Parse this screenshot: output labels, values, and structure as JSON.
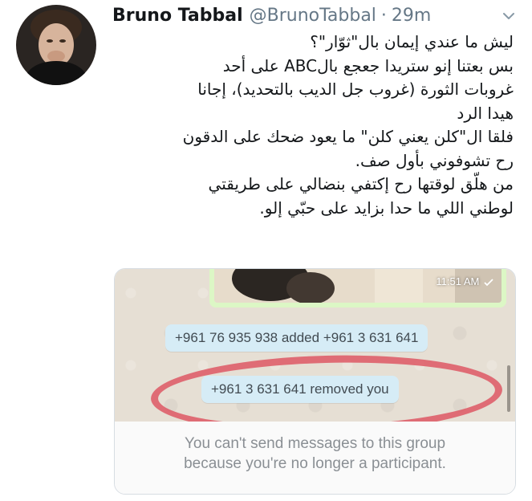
{
  "tweet": {
    "author_name": "Bruno Tabbal",
    "author_handle": "@BrunoTabbal",
    "separator": "·",
    "time": "29m",
    "lines": [
      "ليش ما عندي إيمان بال\"ثوّار\"؟",
      "بس بعتنا إنو ستريدا جعجع بالABC على أحد",
      "غروبات الثورة (غروب جل الديب بالتحديد)، إجانا",
      "هيدا الرد",
      "فلقا ال\"كلن يعني كلن\" ما يعود ضحك على الدقون",
      "رح تشوفوني بأول صف.",
      "من هلّق لوقتها رح إكتفي بنضالي على طريقتي",
      "لوطني اللي ما حدا بزايد على حبّي إلو."
    ]
  },
  "icons": {
    "caret": "chevron-down-icon",
    "read_receipt": "checkmark-icon"
  },
  "screenshot": {
    "message_time": "11:51 AM",
    "system_messages": [
      "+961 76 935 938 added +961 3 631 641",
      "+961 3 631 641 removed you"
    ],
    "footer_line1": "You can't send messages to this group",
    "footer_line2": "because you're no longer a participant."
  },
  "colors": {
    "system_bubble": "#d6ecf6",
    "highlight_circle": "#dd4b5a",
    "outgoing_bubble": "#dcf7c5",
    "chat_background": "#e6dfd4"
  }
}
